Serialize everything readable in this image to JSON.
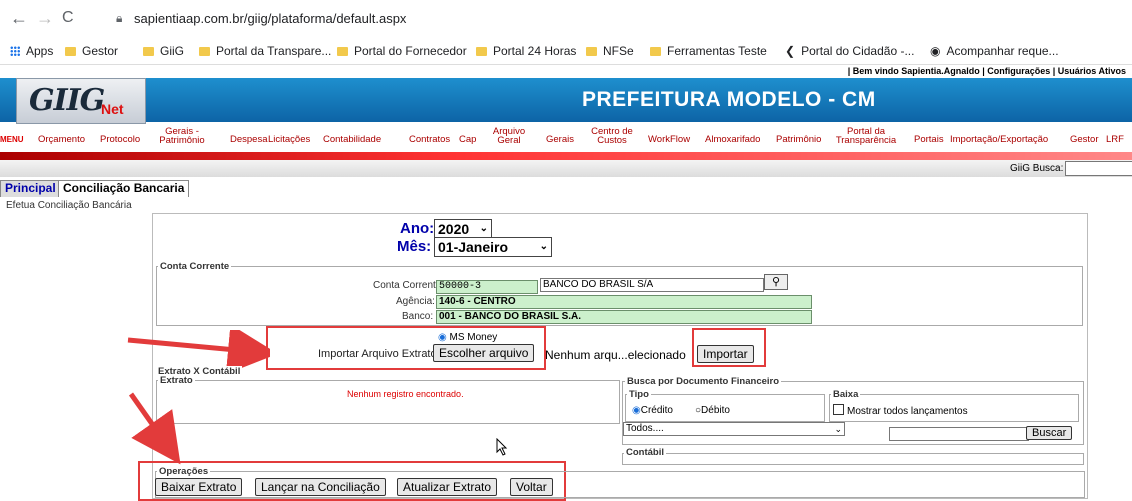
{
  "browser": {
    "url": "sapientiaap.com.br/giig/plataforma/default.aspx",
    "bookmarks": [
      "Apps",
      "Gestor",
      "GiiG",
      "Portal da Transpare...",
      "Portal do Fornecedor",
      "Portal 24 Horas",
      "NFSe",
      "Ferramentas Teste",
      "Portal do Cidadão -...",
      "Acompanhar reque..."
    ]
  },
  "app": {
    "top_links": "| Bem vindo Sapientia.Agnaldo   |  Configurações   |  Usuários Ativos",
    "logo_main": "GIIG",
    "logo_sub": "Net",
    "title": "PREFEITURA MODELO - CM",
    "menu_label": "MENU",
    "menu": [
      "Orçamento",
      "Protocolo",
      "Gerais - Patrimônio",
      "Despesa",
      "Licitações",
      "Contabilidade",
      "Contratos",
      "Cap",
      "Arquivo Geral",
      "Gerais",
      "Centro de Custos",
      "WorkFlow",
      "Almoxarifado",
      "Patrimônio",
      "Portal da Transparência",
      "Portais",
      "Importação/Exportação",
      "Gestor",
      "LRF"
    ],
    "busca_label": "GiiG Busca:"
  },
  "tabs": [
    "Principal",
    "Conciliação Bancaria"
  ],
  "subtitle": "Efetua Conciliação Bancária",
  "form": {
    "ano_label": "Ano:",
    "ano_value": "2020",
    "mes_label": "Mês:",
    "mes_value": "01-Janeiro",
    "conta_legend": "Conta Corrente",
    "conta_label": "Conta Corrente:",
    "conta_value": "50000-3",
    "banco_name": "BANCO DO BRASIL S/A",
    "agencia_label": "Agência:",
    "agencia_value": "140-6  - CENTRO",
    "banco_label": "Banco:",
    "banco_value": "001 - BANCO DO BRASIL S.A.",
    "ms_money": "MS Money",
    "importar_label": "Importar Arquivo Extrato:",
    "escolher": "Escolher arquivo",
    "nenhum": "Nenhum arqu...elecionado",
    "importar_btn": "Importar",
    "extrato_contabil": "Extrato X Contábil",
    "extrato_legend": "Extrato",
    "nenhum_registro": "Nenhum registro encontrado.",
    "busca_doc_legend": "Busca por Documento Financeiro",
    "tipo_legend": "Tipo",
    "credito": "Crédito",
    "debito": "Débito",
    "baixa_legend": "Baixa",
    "mostrar": "Mostrar todos lançamentos",
    "todos": "Todos....",
    "buscar_btn": "Buscar",
    "contabil_legend": "Contábil",
    "operacoes_legend": "Operações",
    "op_buttons": [
      "Baixar Extrato",
      "Lançar na Conciliação",
      "Atualizar Extrato",
      "Voltar"
    ]
  },
  "colors": {
    "accent_red": "#e23b3b",
    "header_blue": "#1677bb"
  }
}
